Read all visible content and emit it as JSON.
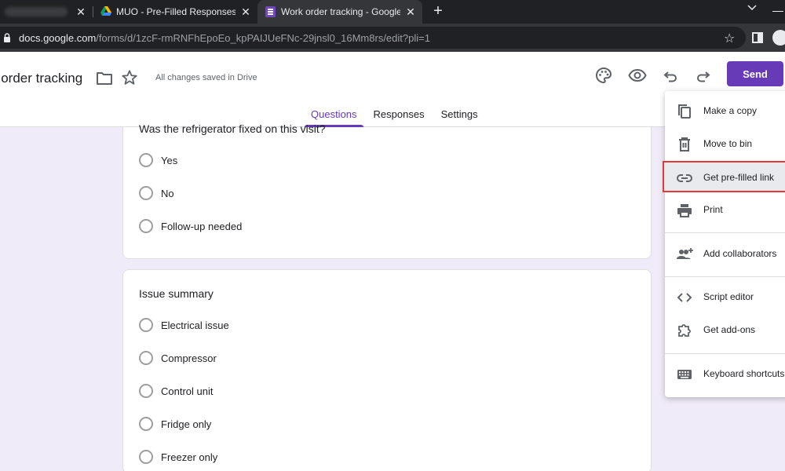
{
  "browser": {
    "tabs": [
      {
        "title": ""
      },
      {
        "title": "MUO - Pre-Filled Responses Goo"
      },
      {
        "title": "Work order tracking - Google Fo"
      }
    ],
    "new_tab": "+",
    "close": "✕",
    "url": {
      "host": "docs.google.com",
      "path": "/forms/d/1zcF-rmRNFhEpoEo_kpPAIJUeFNc-29jnsl0_16Mm8rs/edit?pli=1"
    }
  },
  "header": {
    "title": "k order tracking",
    "saved_status": "All changes saved in Drive",
    "send_label": "Send",
    "tabs": [
      {
        "label": "Questions",
        "active": true
      },
      {
        "label": "Responses",
        "active": false
      },
      {
        "label": "Settings",
        "active": false
      }
    ]
  },
  "cards": [
    {
      "question": "Was the refrigerator fixed on this visit?",
      "options": [
        "Yes",
        "No",
        "Follow-up needed"
      ]
    },
    {
      "question": "Issue summary",
      "options": [
        "Electrical issue",
        "Compressor",
        "Control unit",
        "Fridge only",
        "Freezer only"
      ]
    }
  ],
  "menu": {
    "items": [
      {
        "label": "Make a copy",
        "icon": "copy-icon"
      },
      {
        "label": "Move to bin",
        "icon": "trash-icon"
      },
      {
        "label": "Get pre-filled link",
        "icon": "link-icon",
        "highlighted": true
      },
      {
        "label": "Print",
        "icon": "print-icon"
      },
      {
        "label": "Add collaborators",
        "icon": "add-people-icon"
      },
      {
        "label": "Script editor",
        "icon": "code-icon"
      },
      {
        "label": "Get add-ons",
        "icon": "puzzle-icon"
      },
      {
        "label": "Keyboard shortcuts",
        "icon": "keyboard-icon"
      }
    ]
  },
  "colors": {
    "accent": "#673ab7",
    "highlight_border": "#e53935",
    "background": "#f0ebf8"
  }
}
